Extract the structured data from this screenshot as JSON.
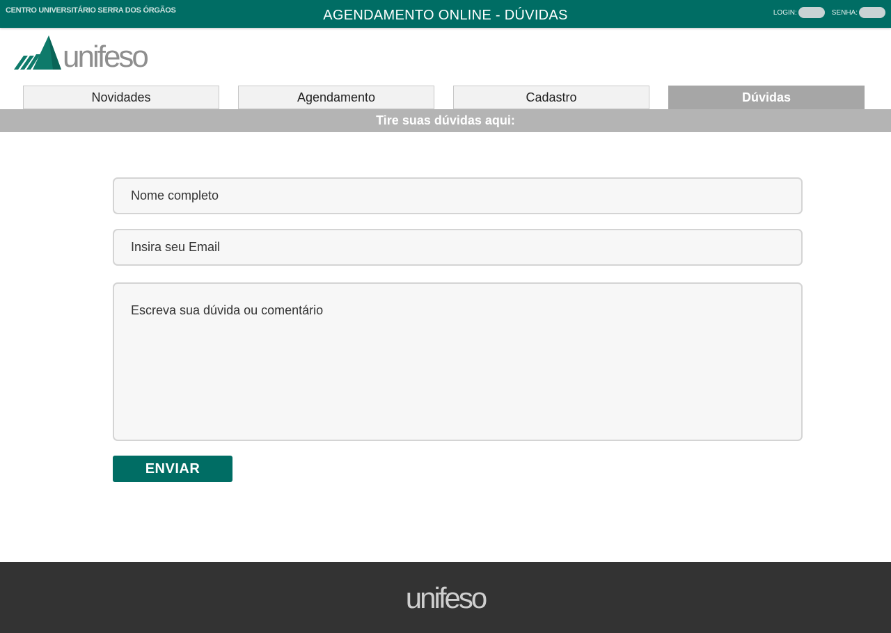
{
  "header": {
    "institution": "CENTRO UNIVERSITÁRIO SERRA DOS ÓRGÃOS",
    "title": "AGENDAMENTO ONLINE  -  DÚVIDAS",
    "login_label": "LOGIN:",
    "password_label": "SENHA:"
  },
  "logo": {
    "text": "unifeso",
    "icon": "mountains-logo-icon"
  },
  "tabs": [
    {
      "label": "Novidades",
      "active": false
    },
    {
      "label": "Agendamento",
      "active": false
    },
    {
      "label": "Cadastro",
      "active": false
    },
    {
      "label": "Dúvidas",
      "active": true
    }
  ],
  "banner": {
    "text": "Tire suas dúvidas aqui:"
  },
  "form": {
    "name_placeholder": "Nome completo",
    "email_placeholder": "Insira seu Email",
    "comment_placeholder": "Escreva sua dúvida ou comentário",
    "submit_label": "ENVIAR"
  },
  "footer": {
    "logo_text": "unifeso"
  },
  "colors": {
    "primary": "#006d64",
    "tab_active": "#a6a6a6",
    "banner": "#b4b4b4",
    "footer": "#333333"
  }
}
